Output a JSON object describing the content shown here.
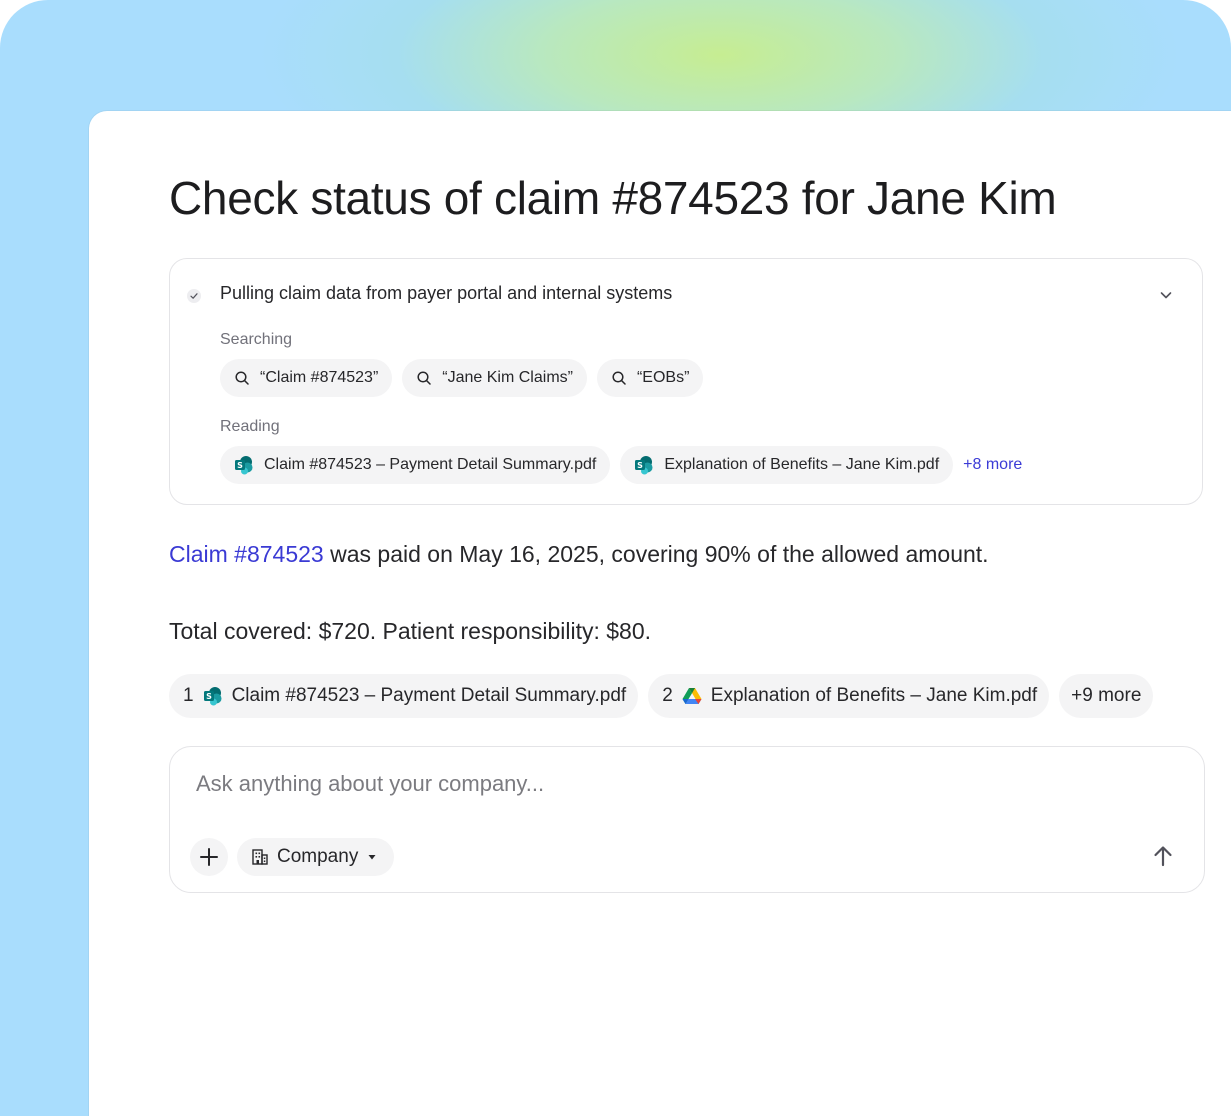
{
  "colors": {
    "accent_link": "#3a3ad4",
    "backdrop_blue": "#a9ddfd",
    "backdrop_green": "#c8ee8c",
    "chip_bg": "#f4f4f5"
  },
  "title": "Check status of claim #874523 for Jane Kim",
  "steps": {
    "status_icon": "check-icon",
    "title": "Pulling claim data from payer portal and internal systems",
    "expand_icon": "chevron-down-icon",
    "searching": {
      "label": "Searching",
      "queries": [
        {
          "icon": "search-icon",
          "text": "“Claim #874523”"
        },
        {
          "icon": "search-icon",
          "text": "“Jane Kim Claims”"
        },
        {
          "icon": "search-icon",
          "text": "“EOBs”"
        }
      ]
    },
    "reading": {
      "label": "Reading",
      "files": [
        {
          "icon": "sharepoint-icon",
          "name": "Claim #874523 – Payment Detail Summary.pdf"
        },
        {
          "icon": "sharepoint-icon",
          "name": "Explanation of Benefits – Jane Kim.pdf"
        }
      ],
      "more": "+8 more"
    }
  },
  "answer": {
    "claim_link": "Claim #874523",
    "line1_rest": " was paid on May 16, 2025, covering 90% of the allowed amount.",
    "line2": "Total covered: $720. Patient responsibility: $80."
  },
  "sources": [
    {
      "index": "1",
      "icon": "sharepoint-icon",
      "name": "Claim #874523 – Payment Detail Summary.pdf"
    },
    {
      "index": "2",
      "icon": "google-drive-icon",
      "name": "Explanation of Benefits – Jane Kim.pdf"
    }
  ],
  "sources_more": "+9 more",
  "composer": {
    "placeholder": "Ask anything about your company...",
    "value": "",
    "add_icon": "plus-icon",
    "scope_icon": "building-icon",
    "scope_label": "Company",
    "scope_caret_icon": "caret-down-icon",
    "send_icon": "arrow-up-icon"
  }
}
